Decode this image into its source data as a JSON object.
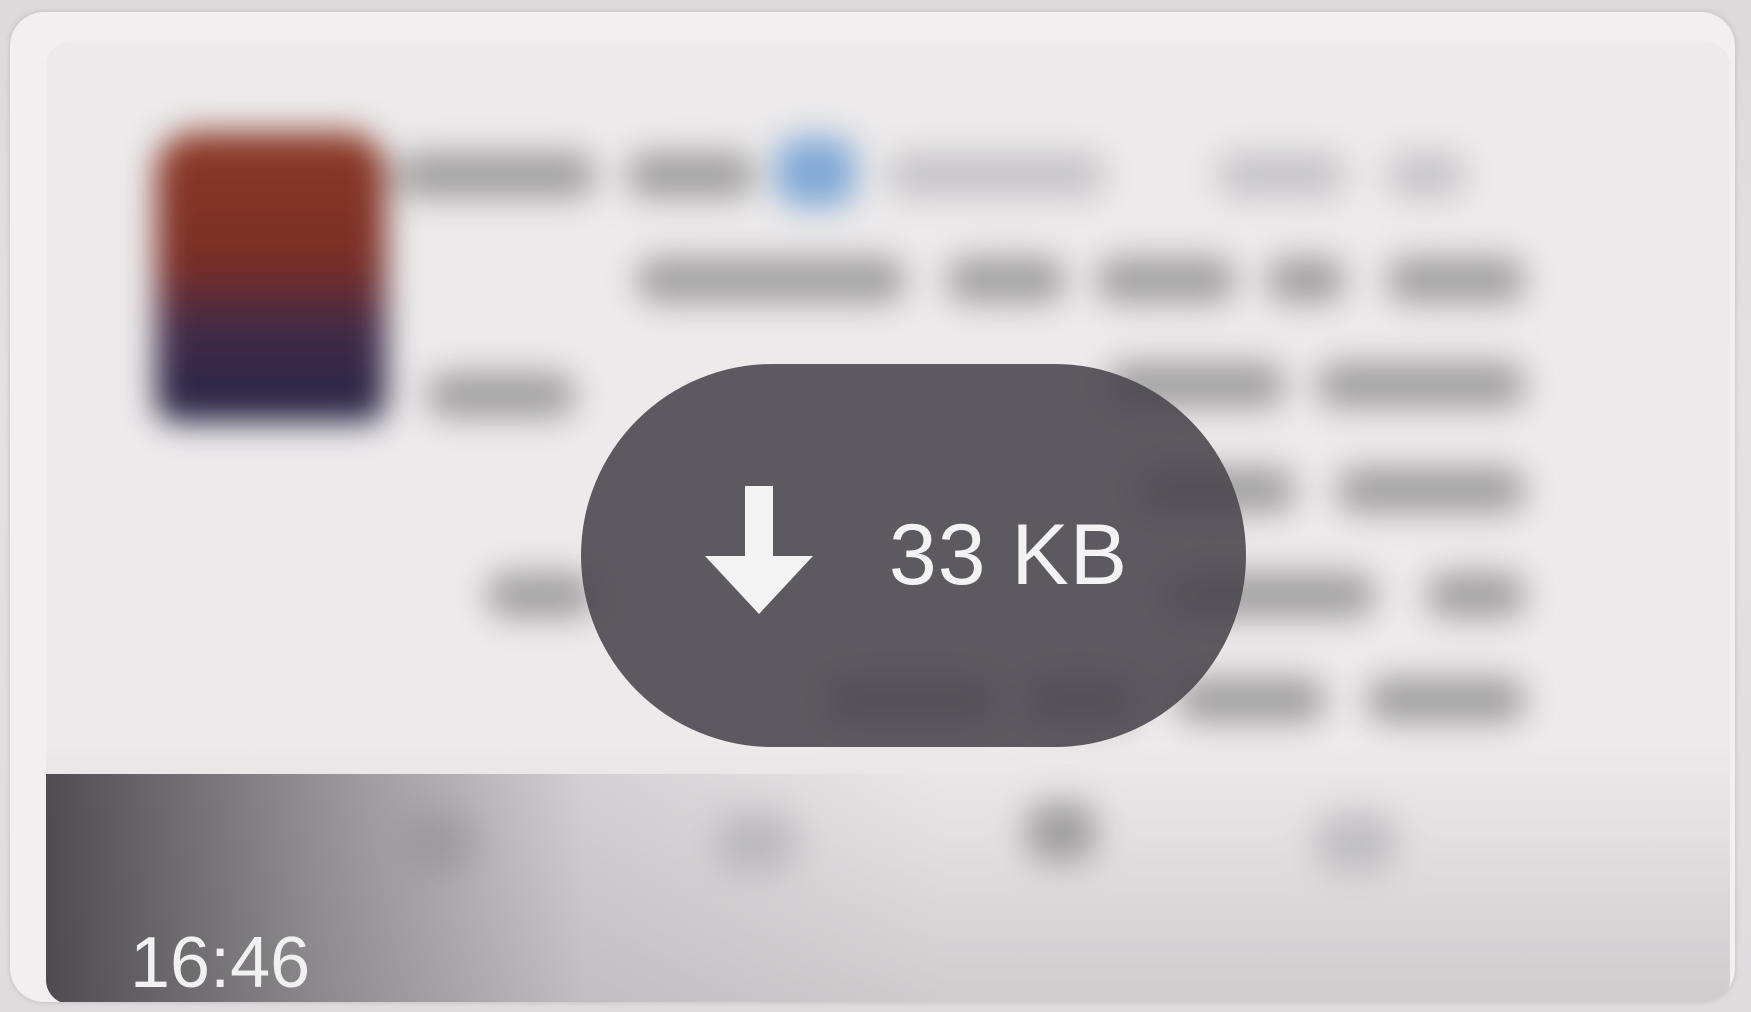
{
  "message": {
    "attachment": {
      "type": "image",
      "state": "not-downloaded",
      "download_icon": "arrow-down-icon",
      "size_label": "33 KB"
    },
    "timestamp": "16:46"
  },
  "colors": {
    "pill_background": "#48464c",
    "text": "#f4f3f4",
    "bubble": "#f1eff0"
  }
}
